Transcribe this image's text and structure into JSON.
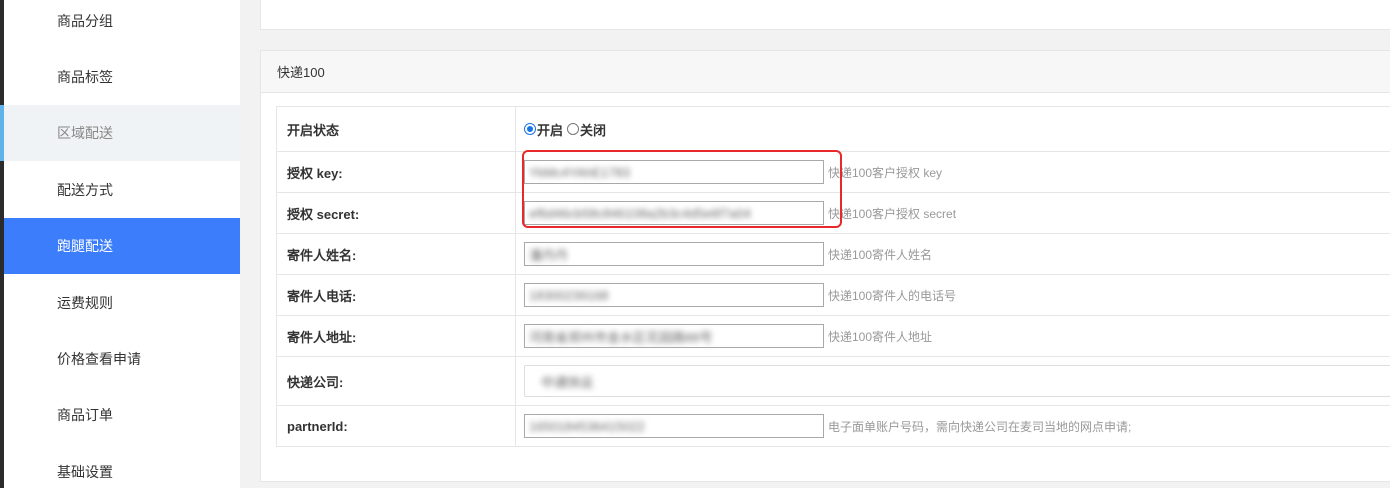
{
  "sidebar": {
    "items": [
      {
        "label": "商品分组",
        "state": "normal"
      },
      {
        "label": "商品标签",
        "state": "normal"
      },
      {
        "label": "区域配送",
        "state": "muted"
      },
      {
        "label": "配送方式",
        "state": "normal"
      },
      {
        "label": "跑腿配送",
        "state": "active"
      },
      {
        "label": "运费规则",
        "state": "normal"
      },
      {
        "label": "价格查看申请",
        "state": "normal"
      },
      {
        "label": "商品订单",
        "state": "normal"
      },
      {
        "label": "基础设置",
        "state": "normal"
      }
    ]
  },
  "panel": {
    "title": "快递100",
    "rows": {
      "status": {
        "label": "开启状态",
        "on_label": "开启",
        "off_label": "关闭",
        "selected": "on"
      },
      "key": {
        "label": "授权 key:",
        "value": "YkMc4YAhE1783",
        "hint": "快递100客户授权 key"
      },
      "secret": {
        "label": "授权 secret:",
        "value": "ef6d46cb58c846108a2b3c4d5e6f7a04",
        "hint": "快递100客户授权 secret"
      },
      "sender_name": {
        "label": "寄件人姓名:",
        "value": "潘丹丹",
        "hint": "快递100寄件人姓名"
      },
      "sender_phone": {
        "label": "寄件人电话:",
        "value": "18300239168",
        "hint": "快递100寄件人的电话号"
      },
      "sender_address": {
        "label": "寄件人地址:",
        "value": "河南省郑州市金水区花园路88号",
        "hint": "快递100寄件人地址"
      },
      "company": {
        "label": "快递公司:",
        "value": "中通快运"
      },
      "partner": {
        "label": "partnerId:",
        "value": "1650184536415022",
        "hint": "电子面单账户号码，需向快递公司在麦司当地的网点申请;"
      }
    }
  },
  "colors": {
    "active_nav": "#3b7dfa",
    "highlight_border": "#e8292b",
    "radio_checked": "#1a73e8"
  }
}
